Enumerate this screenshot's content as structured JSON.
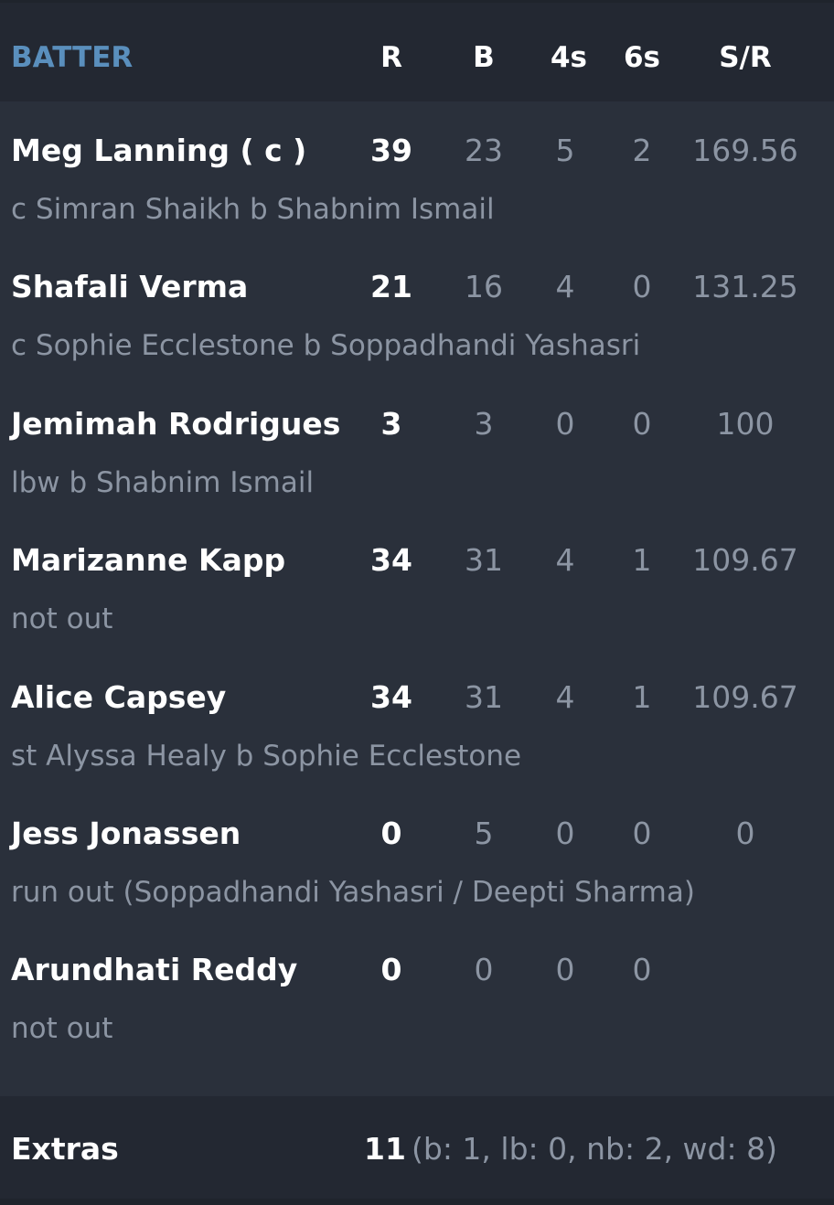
{
  "header": {
    "batter": "BATTER",
    "runs": "R",
    "balls": "B",
    "fours": "4s",
    "sixes": "6s",
    "strike_rate": "S/R"
  },
  "batters": [
    {
      "name": "Meg Lanning ( c )",
      "dismissal": "c Simran Shaikh b Shabnim Ismail",
      "runs": "39",
      "balls": "23",
      "fours": "5",
      "sixes": "2",
      "sr": "169.56"
    },
    {
      "name": "Shafali Verma",
      "dismissal": "c Sophie Ecclestone b Soppadhandi Yashasri",
      "runs": "21",
      "balls": "16",
      "fours": "4",
      "sixes": "0",
      "sr": "131.25"
    },
    {
      "name": "Jemimah Rodrigues",
      "dismissal": "lbw b Shabnim Ismail",
      "runs": "3",
      "balls": "3",
      "fours": "0",
      "sixes": "0",
      "sr": "100"
    },
    {
      "name": "Marizanne Kapp",
      "dismissal": "not out",
      "runs": "34",
      "balls": "31",
      "fours": "4",
      "sixes": "1",
      "sr": "109.67"
    },
    {
      "name": "Alice Capsey",
      "dismissal": "st Alyssa Healy b Sophie Ecclestone",
      "runs": "34",
      "balls": "31",
      "fours": "4",
      "sixes": "1",
      "sr": "109.67"
    },
    {
      "name": "Jess Jonassen",
      "dismissal": "run out (Soppadhandi Yashasri / Deepti Sharma)",
      "runs": "0",
      "balls": "5",
      "fours": "0",
      "sixes": "0",
      "sr": "0"
    },
    {
      "name": "Arundhati Reddy",
      "dismissal": "not out",
      "runs": "0",
      "balls": "0",
      "fours": "0",
      "sixes": "0",
      "sr": ""
    }
  ],
  "extras": {
    "label": "Extras",
    "total": "11",
    "breakdown": "(b: 1, lb: 0, nb: 2, wd: 8)"
  },
  "colors": {
    "background": "#2a303b",
    "header_background": "#232832",
    "accent": "#5a8fbd",
    "muted_text": "#8c95a3"
  }
}
